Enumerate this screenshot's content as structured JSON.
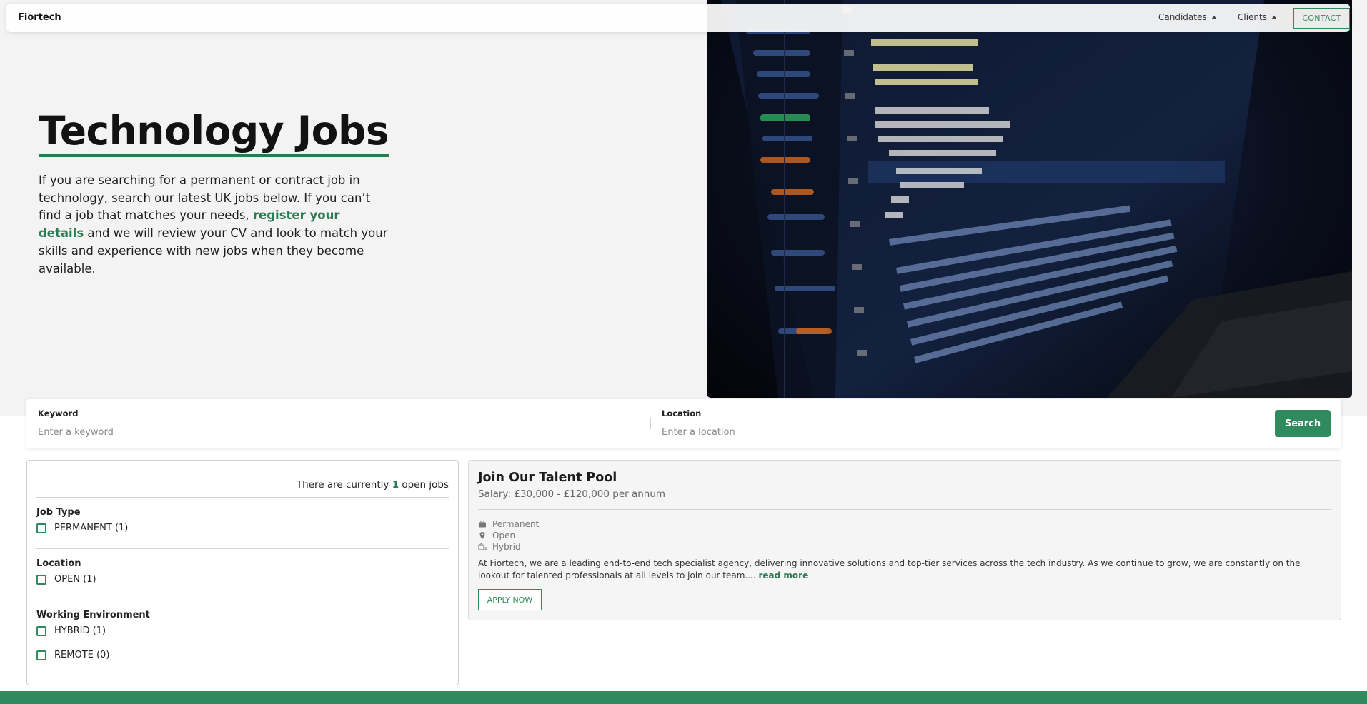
{
  "navbar": {
    "brand": "Fiortech",
    "candidates_label": "Candidates",
    "clients_label": "Clients",
    "contact_label": "CONTACT"
  },
  "hero": {
    "title": "Technology Jobs",
    "text_before": "If you are searching for a permanent or contract job in technology, search our latest UK jobs below. If you can’t find a job that matches your needs, ",
    "link_text": "register your details",
    "text_after": " and we will review your CV and look to match your skills and experience with new jobs when they become available.",
    "image": "laptop-code-editor-photo"
  },
  "search": {
    "keyword_label": "Keyword",
    "keyword_placeholder": "Enter a keyword",
    "location_label": "Location",
    "location_placeholder": "Enter a location",
    "button_label": "Search"
  },
  "filters": {
    "count_prefix": "There are currently ",
    "count_value": "1",
    "count_suffix": " open jobs",
    "groups": [
      {
        "heading": "Job Type",
        "options": [
          {
            "label": "PERMANENT (1)"
          }
        ]
      },
      {
        "heading": "Location",
        "options": [
          {
            "label": "OPEN (1)"
          }
        ]
      },
      {
        "heading": "Working Environment",
        "options": [
          {
            "label": "HYBRID (1)"
          },
          {
            "label": "REMOTE (0)"
          }
        ]
      }
    ]
  },
  "job": {
    "title": "Join Our Talent Pool",
    "salary": "Salary: £30,000 - £120,000 per annum",
    "meta": [
      {
        "icon": "briefcase-icon",
        "text": "Permanent"
      },
      {
        "icon": "map-pin-icon",
        "text": "Open"
      },
      {
        "icon": "hybrid-icon",
        "text": "Hybrid"
      }
    ],
    "description": "At Fiortech, we are a leading end-to-end tech specialist agency, delivering innovative solutions and top-tier services across the tech industry. As we continue to grow, we are constantly on the lookout for talented professionals at all levels to join our team.... ",
    "read_more": "read more",
    "apply_label": "APPLY NOW"
  },
  "colors": {
    "accent": "#2f8a5d",
    "accent_dark": "#2a7a52",
    "hero_bg": "#f3f3f3"
  }
}
